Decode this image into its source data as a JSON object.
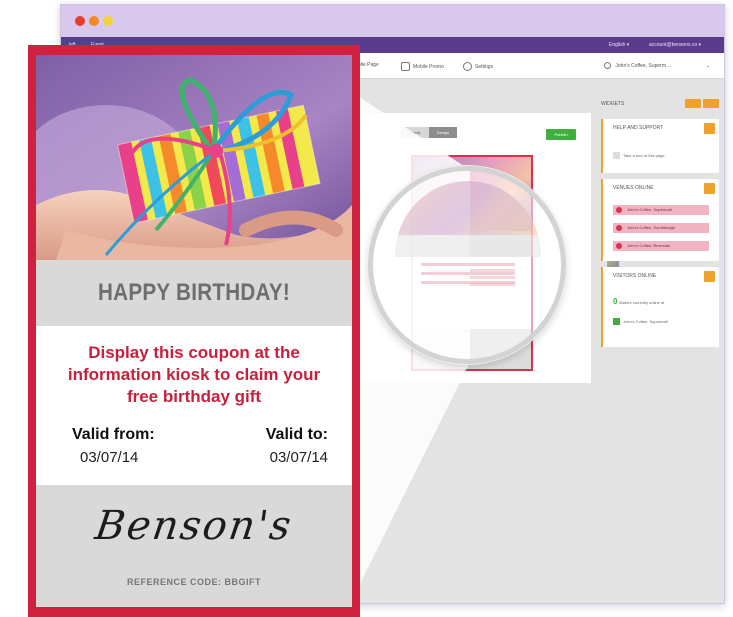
{
  "app": {
    "topbar": {
      "left_links": [
        "left",
        "Event"
      ],
      "language": "English ▾",
      "account": "account@bensons.co ▾"
    },
    "toolbar": {
      "items": [
        "Mobile Page",
        "Mobile Promo",
        "Settings"
      ],
      "venue_selector": "John's Coffee, Superm…"
    },
    "editor": {
      "segment_a": "Mobile",
      "segment_b": "Design",
      "publish": "Publish"
    },
    "widgets": {
      "title": "WIDGETS",
      "help": {
        "title": "HELP AND SUPPORT",
        "row": "Take a tour of this page"
      },
      "venues": {
        "title": "VENUES ONLINE",
        "rows": [
          "John's Coffee, Supermall",
          "John's Coffee, Southbridge",
          "John's Coffee, Riverside"
        ]
      },
      "visitors": {
        "title": "VISITORS ONLINE",
        "count": "0",
        "count_label": "Visitors currently online at",
        "row": "John's Coffee, Supermall"
      }
    }
  },
  "coupon": {
    "heading": "HAPPY BIRTHDAY!",
    "message": "Display this coupon at the information kiosk to claim your free birthday gift",
    "valid_from_label": "Valid from:",
    "valid_from_date": "03/07/14",
    "valid_to_label": "Valid to:",
    "valid_to_date": "03/07/14",
    "logo_text": "Benson's",
    "reference": "REFERENCE CODE: BBGIFT"
  },
  "colors": {
    "coupon_border": "#d0223f",
    "message_text": "#c8203c",
    "app_header": "#5a3c8e",
    "widget_accent": "#f0a12c",
    "publish_green": "#3fae3c"
  }
}
